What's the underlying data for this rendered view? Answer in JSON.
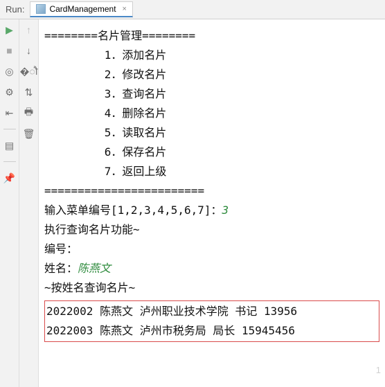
{
  "header": {
    "run_label": "Run:",
    "tab_name": "CardManagement",
    "close_x": "×"
  },
  "gutter1": {
    "play": "▶",
    "square": "■",
    "camera": "◎",
    "bug": "⚙",
    "exit": "⇤",
    "layout": "▤",
    "pin": "📌"
  },
  "gutter2": {
    "up": "↑",
    "down": "↓",
    "overline": "�ौ",
    "wrap": "⇅",
    "print": "🖶",
    "trash": "🗑"
  },
  "console": {
    "title_line": "========名片管理========",
    "menu": [
      "         1．添加名片",
      "         2．修改名片",
      "         3．查询名片",
      "         4．删除名片",
      "         5．读取名片",
      "         6．保存名片",
      "         7．返回上级"
    ],
    "divider": "========================",
    "prompt1": "输入菜单编号[1,2,3,4,5,6,7]：",
    "input1": "3",
    "exec_msg": "执行查询名片功能~",
    "id_label": "编号：",
    "name_label": "姓名：",
    "name_input": "陈燕文",
    "search_msg": "~按姓名查询名片~",
    "rows": [
      "2022002 陈燕文 泸州职业技术学院 书记 13956",
      "2022003 陈燕文 泸州市税务局 局长 15945456"
    ]
  },
  "watermark": "1"
}
